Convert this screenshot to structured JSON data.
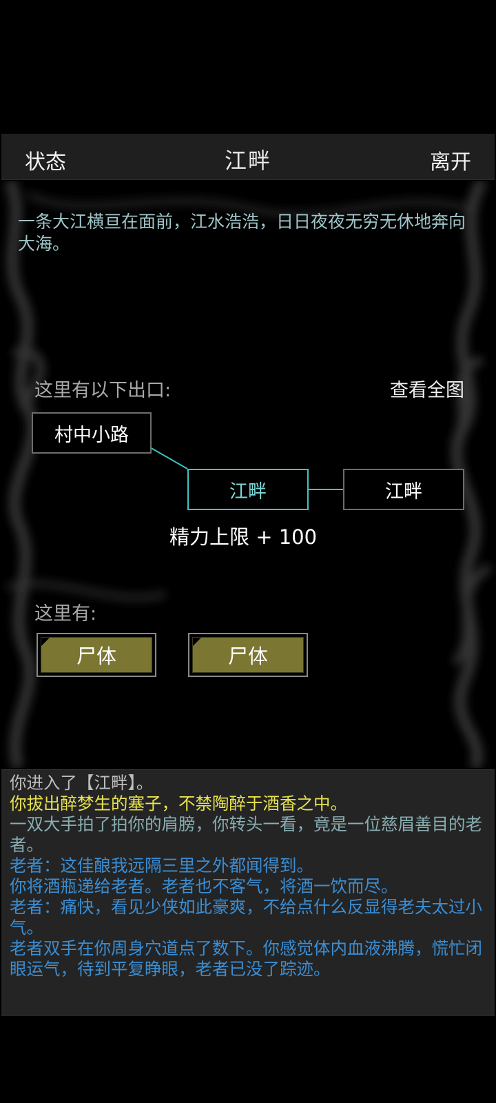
{
  "header": {
    "left_label": "状态",
    "title": "江畔",
    "right_label": "离开"
  },
  "scene": {
    "description": "一条大江横亘在面前，江水浩浩，日日夜夜无穷无休地奔向大海。",
    "exits_label": "这里有以下出口:",
    "view_map_label": "查看全图",
    "rooms": {
      "north": "村中小路",
      "current": "江畔",
      "east": "江畔"
    },
    "bonus_text": "精力上限 + 100",
    "here_label": "这里有:",
    "items": [
      "尸体",
      "尸体"
    ]
  },
  "log": [
    {
      "text": "你进入了【江畔】。",
      "color": "gray"
    },
    {
      "text": "你拔出醉梦生的塞子，不禁陶醉于酒香之中。",
      "color": "yellow"
    },
    {
      "text": "一双大手拍了拍你的肩膀，你转头一看，竟是一位慈眉善目的老者。",
      "color": "teal"
    },
    {
      "text": "老者：这佳酿我远隔三里之外都闻得到。",
      "color": "blue"
    },
    {
      "text": "你将酒瓶递给老者。老者也不客气，将酒一饮而尽。",
      "color": "blue"
    },
    {
      "text": "老者：痛快，看见少侠如此豪爽，不给点什么反显得老夫太过小气。",
      "color": "blue"
    },
    {
      "text": "老者双手在你周身穴道点了数下。你感觉体内血液沸腾，慌忙闭眼运气，待到平复睁眼，老者已没了踪迹。",
      "color": "blue"
    }
  ],
  "colors": {
    "current_room_border": "#3ec4c4",
    "item_fill": "#7b7631",
    "log_yellow": "#e7e24e",
    "log_blue": "#3b8ed4",
    "log_teal": "#89adb1"
  }
}
